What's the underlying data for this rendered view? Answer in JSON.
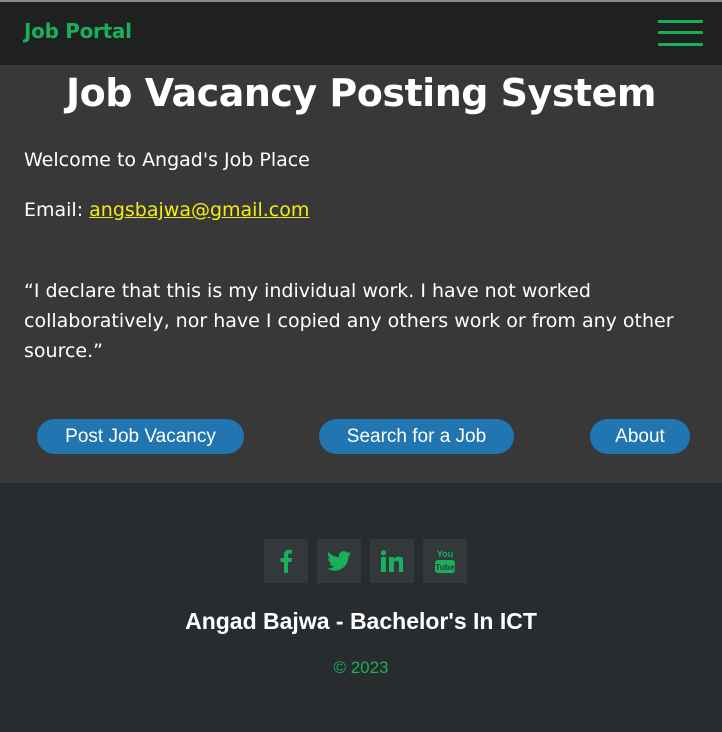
{
  "navbar": {
    "brand": "Job Portal",
    "menu_icon": "hamburger-menu-icon"
  },
  "main": {
    "title": "Job Vacancy Posting System",
    "welcome": "Welcome to Angad's Job Place",
    "email_label": "Email: ",
    "email": "angsbajwa@gmail.com",
    "declaration": "“I declare that this is my individual work. I have not worked collaboratively, nor have I copied any others work or from any other source.”",
    "buttons": {
      "post": "Post Job Vacancy",
      "search": "Search for a Job",
      "about": "About"
    }
  },
  "footer": {
    "socials": [
      "facebook-icon",
      "twitter-icon",
      "linkedin-icon",
      "youtube-icon"
    ],
    "name": "Angad Bajwa - Bachelor's In ICT",
    "copyright": "© 2023"
  },
  "colors": {
    "accent_green": "#16b15a",
    "button_blue": "#2175b0",
    "link_yellow": "#f1ec1a",
    "navbar_bg": "#1f2020",
    "main_bg": "#373837",
    "footer_bg": "#292c2f"
  }
}
